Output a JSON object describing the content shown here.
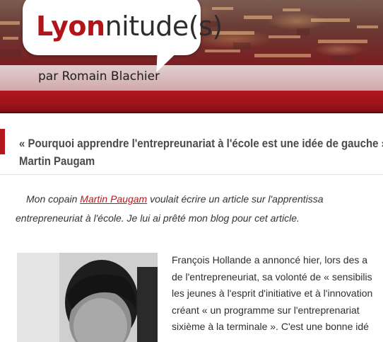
{
  "header": {
    "logo_red": "Lyon",
    "logo_dark": "nitude(s)",
    "byline": "par Romain Blachier"
  },
  "post": {
    "title_line1": "« Pourquoi apprendre l'entrepreunariat à l'école est une idée de gauche »",
    "title_line2": "Martin Paugam",
    "intro_before_link": "Mon copain ",
    "intro_link": "Martin Paugam",
    "intro_after_link": " voulait écrire un article sur l'apprentissa",
    "intro_line2": "entrepreneuriat à l'école. Je lui ai prêté mon blog pour cet article.",
    "body_lines": [
      "François Hollande a annoncé hier, lors des a",
      "de l'entrepreneuriat, sa volonté de « sensibilis",
      "les jeunes à l'esprit d'initiative et à l'innovation",
      "créant « un programme sur l'entreprenariat",
      "sixième à la terminale ». C'est une bonne idé"
    ]
  },
  "colors": {
    "accent": "#b3141a",
    "banner": "#8d1b1f",
    "title_text": "#4a4a4a"
  }
}
